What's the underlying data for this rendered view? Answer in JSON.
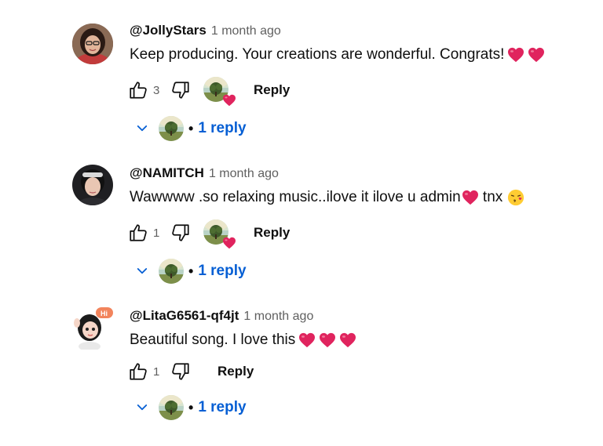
{
  "comments": [
    {
      "author": "@JollyStars",
      "time": "1 month ago",
      "text": "Keep producing. Your creations are wonderful. Congrats!",
      "trailing_emojis": [
        "red-heart",
        "red-heart"
      ],
      "likes": "3",
      "reply_label": "Reply",
      "replies_label": "1 reply",
      "hearted_by_creator": true
    },
    {
      "author": "@NAMITCH",
      "time": "1 month ago",
      "text": "Wawwww .so relaxing music..ilove it ilove u admin",
      "text_after_heart": " tnx",
      "trailing_emojis": [
        "red-heart",
        "face-blowing-kiss"
      ],
      "likes": "1",
      "reply_label": "Reply",
      "replies_label": "1 reply",
      "hearted_by_creator": true
    },
    {
      "author": "@LitaG6561-qf4jt",
      "time": "1 month ago",
      "text": "Beautiful song. I love this",
      "trailing_emojis": [
        "red-heart",
        "red-heart",
        "red-heart"
      ],
      "likes": "1",
      "reply_label": "Reply",
      "replies_label": "1 reply",
      "hearted_by_creator": false
    }
  ],
  "reply_separator": "•",
  "colors": {
    "link_blue": "#065fd4",
    "heart_red": "#e0245e",
    "secondary_text": "#606060",
    "primary_text": "#0f0f0f"
  }
}
